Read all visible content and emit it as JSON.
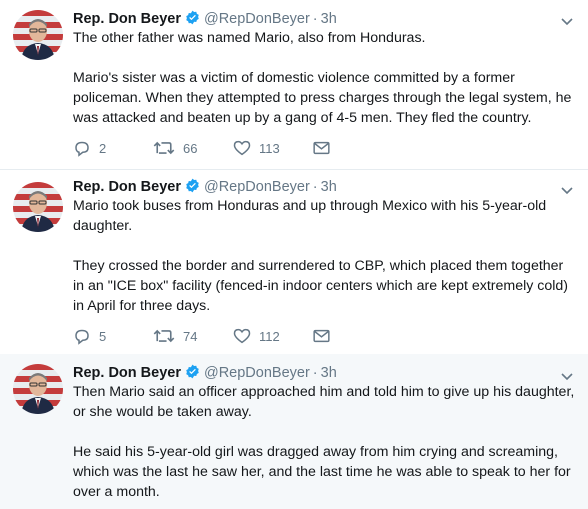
{
  "account": {
    "name": "Rep. Don Beyer",
    "handle": "@RepDonBeyer",
    "separator": "·"
  },
  "tweets": [
    {
      "time": "3h",
      "paragraphs": [
        "The other father was named Mario, also from Honduras.",
        "Mario's sister was a victim of domestic violence committed by a former policeman. When they attempted to press charges through the legal system, he was attacked and beaten up by a gang of 4-5 men. They fled the country."
      ],
      "replies": "2",
      "retweets": "66",
      "likes": "113"
    },
    {
      "time": "3h",
      "paragraphs": [
        "Mario took buses from Honduras and up through Mexico with his 5-year-old daughter.",
        "They crossed the border and surrendered to CBP, which placed them together in an \"ICE box\" facility (fenced-in indoor centers which are kept extremely cold) in April for three days."
      ],
      "replies": "5",
      "retweets": "74",
      "likes": "112"
    },
    {
      "time": "3h",
      "paragraphs": [
        "Then Mario said an officer approached him and told him to give up his daughter, or she would be taken away.",
        "He said his 5-year-old girl was dragged away from him crying and screaming, which was the last he saw her, and the last time he was able to speak to her for over a month."
      ]
    }
  ],
  "icons": {
    "reply": "reply-icon",
    "retweet": "retweet-icon",
    "like": "heart-icon",
    "dm": "envelope-icon",
    "verified": "verified-badge-icon",
    "caret": "chevron-down-icon"
  },
  "colors": {
    "text": "#14171a",
    "muted": "#657786",
    "verified": "#1da1f2",
    "selected_bg": "#f5f8fa",
    "thread_line": "#ccd6dd"
  }
}
